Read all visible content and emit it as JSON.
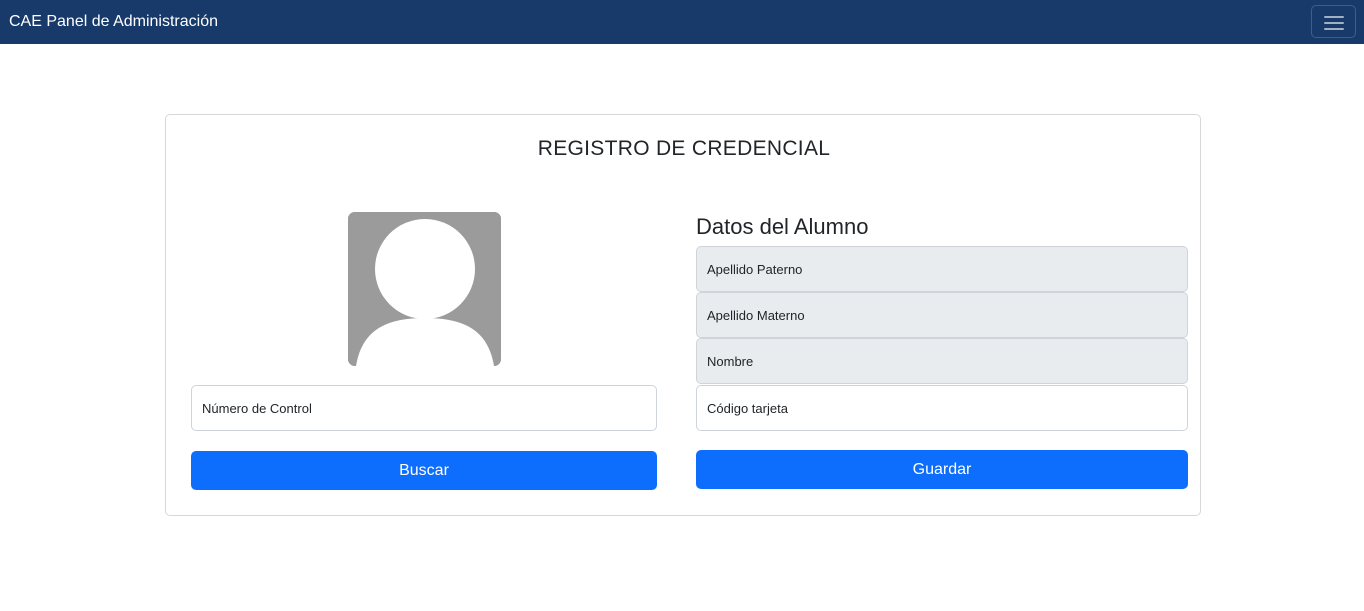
{
  "navbar": {
    "brand": "CAE Panel de Administración",
    "toggler_icon": "hamburger-menu-icon"
  },
  "card": {
    "title": "REGISTRO DE CREDENCIAL",
    "avatar_icon": "user-placeholder-icon",
    "control_number": {
      "placeholder": "Número de Control",
      "value": ""
    },
    "search_button": "Buscar",
    "student_section": {
      "title": "Datos del Alumno",
      "fields": [
        {
          "placeholder": "Apellido Paterno",
          "value": ""
        },
        {
          "placeholder": "Apellido Materno",
          "value": ""
        },
        {
          "placeholder": "Nombre",
          "value": ""
        },
        {
          "placeholder": "Código tarjeta",
          "value": ""
        }
      ]
    },
    "save_button": "Guardar"
  },
  "colors": {
    "navbar": "#183a6b",
    "primary": "#0d6efd",
    "readonly_field": "#e9ecef",
    "avatar_bg": "#9b9b9b"
  }
}
